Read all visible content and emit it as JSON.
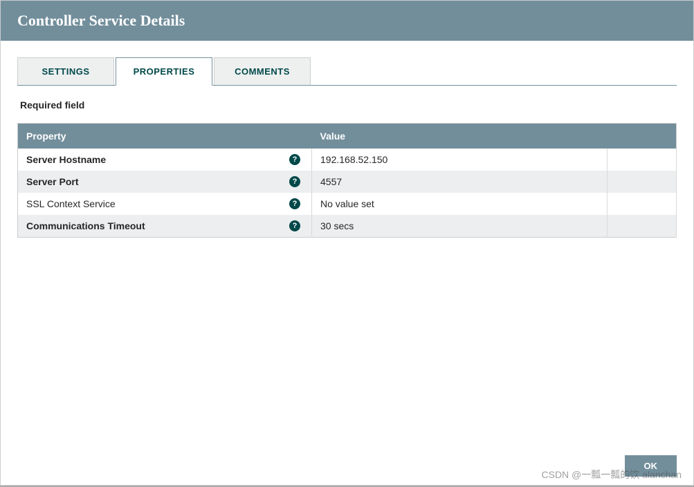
{
  "dialog": {
    "title": "Controller Service Details",
    "ok_label": "OK"
  },
  "tabs": {
    "settings": "SETTINGS",
    "properties": "PROPERTIES",
    "comments": "COMMENTS"
  },
  "properties_tab": {
    "required_label": "Required field",
    "headers": {
      "property": "Property",
      "value": "Value"
    },
    "rows": [
      {
        "name": "Server Hostname",
        "value": "192.168.52.150",
        "required": true,
        "has_value": true
      },
      {
        "name": "Server Port",
        "value": "4557",
        "required": true,
        "has_value": true
      },
      {
        "name": "SSL Context Service",
        "value": "No value set",
        "required": false,
        "has_value": false
      },
      {
        "name": "Communications Timeout",
        "value": "30 secs",
        "required": true,
        "has_value": true
      }
    ]
  },
  "watermark": "CSDN @一瓢一瓢的饮 alanchan"
}
